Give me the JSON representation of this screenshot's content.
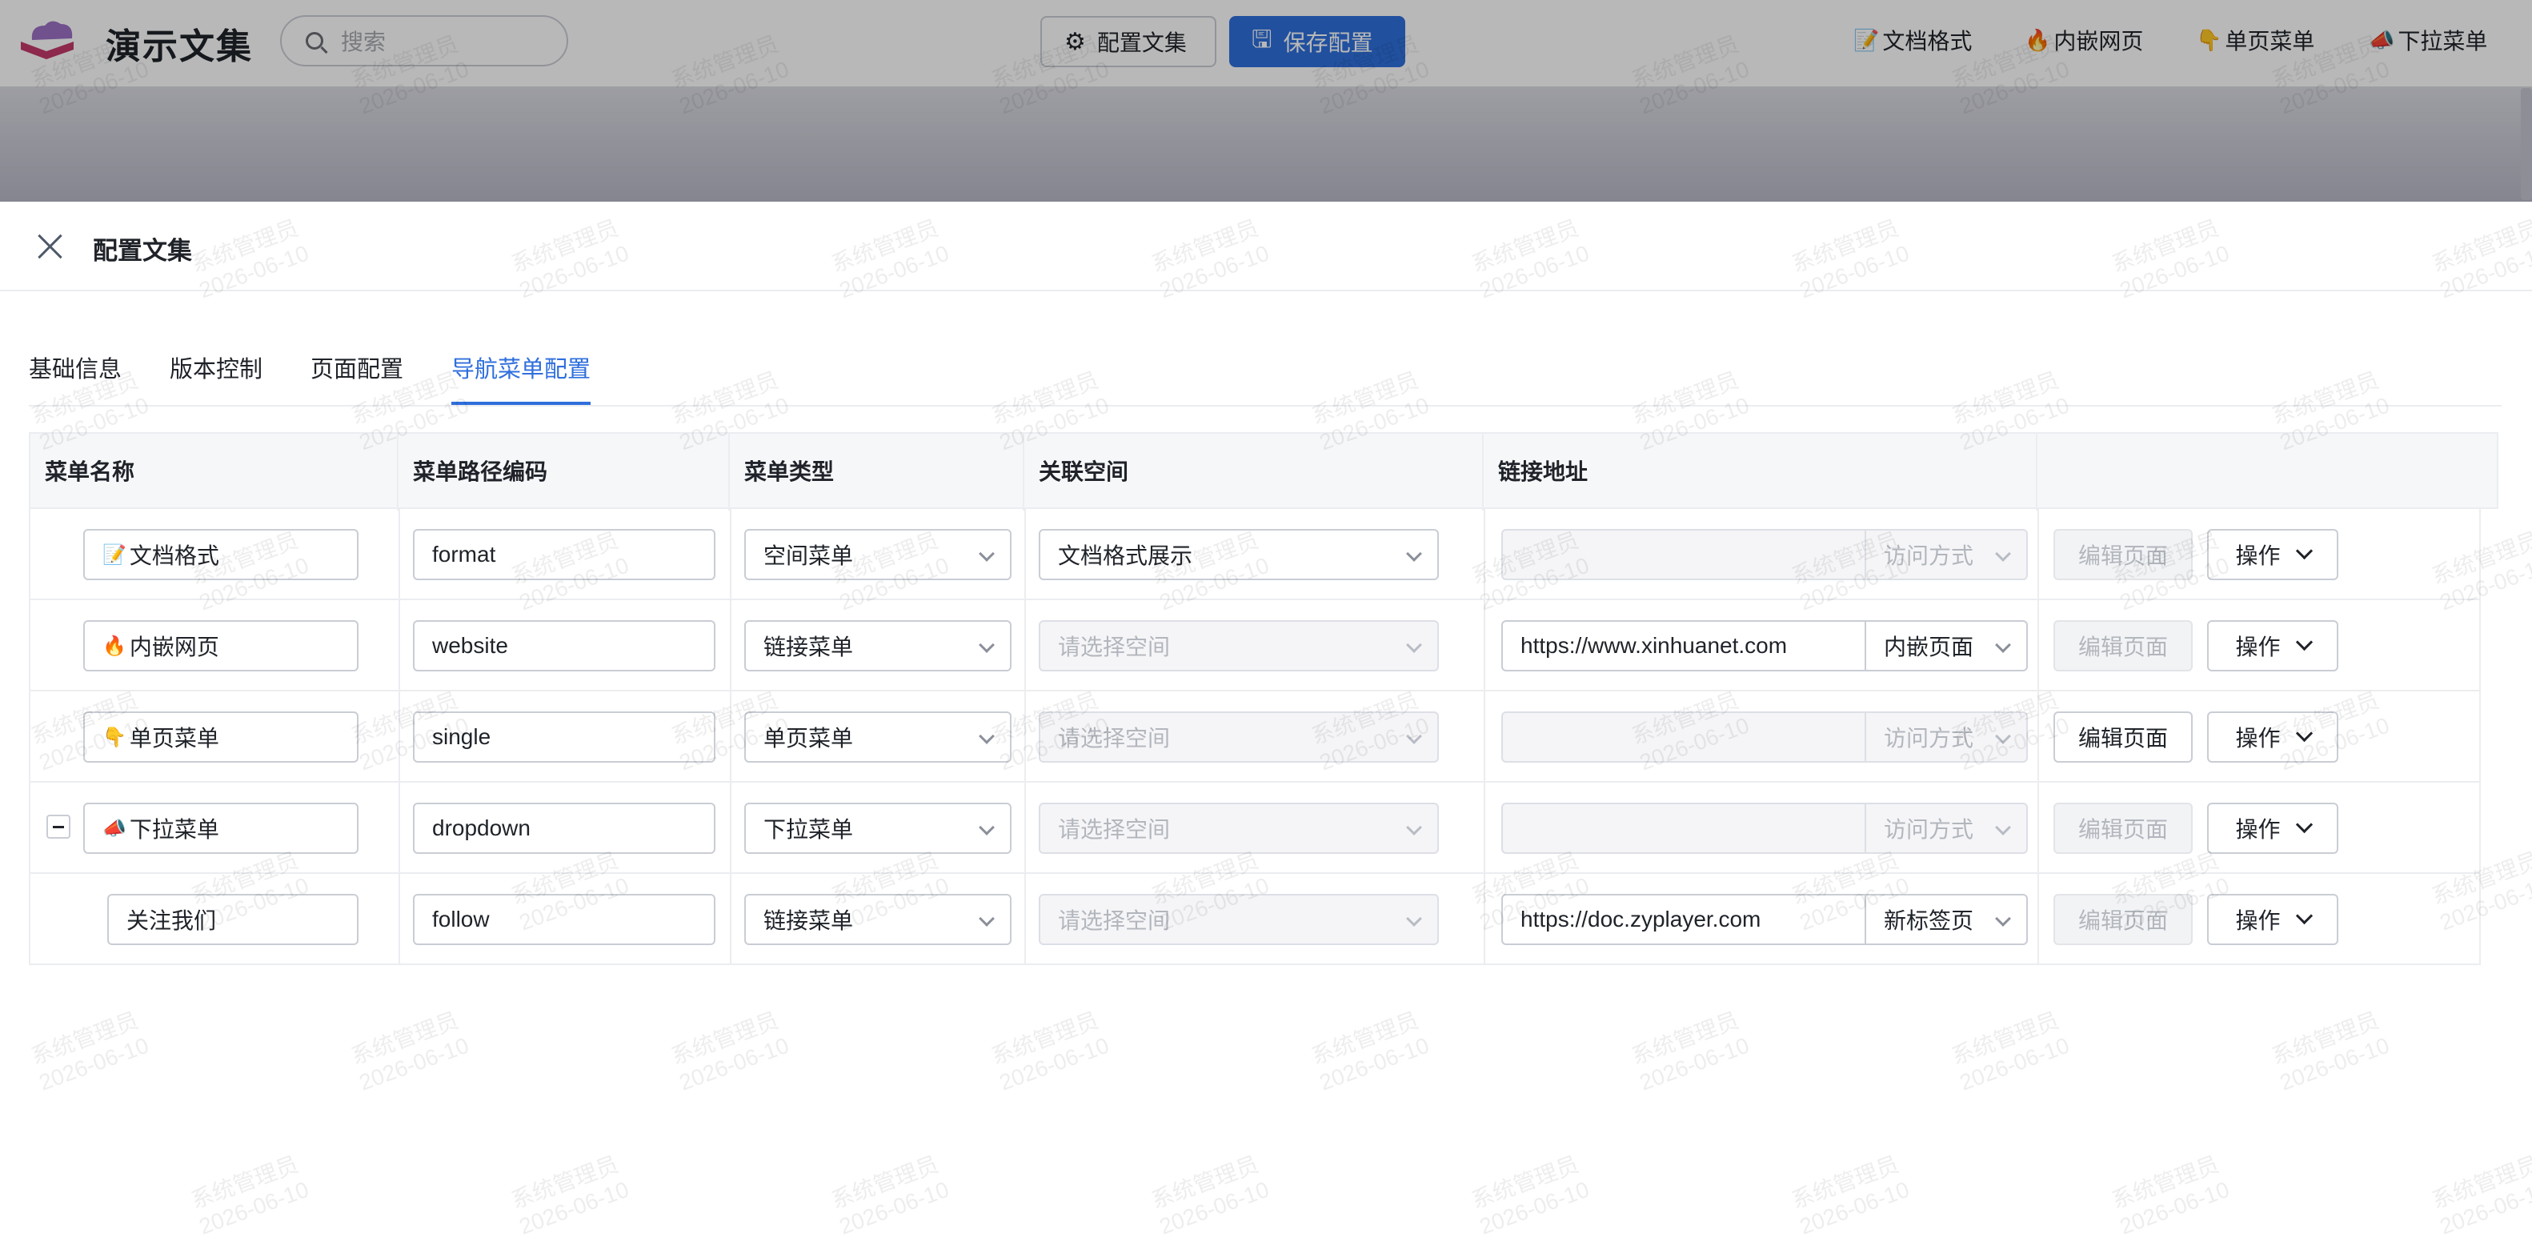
{
  "header": {
    "app_title": "演示文集",
    "search_placeholder": "搜索",
    "config_button": "配置文集",
    "save_button": "保存配置",
    "nav": [
      {
        "icon": "📝",
        "label": "文档格式"
      },
      {
        "icon": "🔥",
        "label": "内嵌网页"
      },
      {
        "icon": "👇",
        "label": "单页菜单"
      },
      {
        "icon": "📣",
        "label": "下拉菜单"
      }
    ]
  },
  "drawer": {
    "title": "配置文集",
    "tabs": [
      "基础信息",
      "版本控制",
      "页面配置",
      "导航菜单配置"
    ],
    "active_tab": "导航菜单配置"
  },
  "table": {
    "columns": [
      "菜单名称",
      "菜单路径编码",
      "菜单类型",
      "关联空间",
      "链接地址",
      ""
    ],
    "rows": [
      {
        "icon": "📝",
        "name": "文档格式",
        "code": "format",
        "type": "空间菜单",
        "space": "文档格式展示",
        "space_disabled": false,
        "url": "",
        "url_placeholder": "",
        "url_disabled": true,
        "access": "访问方式",
        "access_disabled": true,
        "edit": "编辑页面",
        "edit_disabled": true,
        "action": "操作"
      },
      {
        "icon": "🔥",
        "name": "内嵌网页",
        "code": "website",
        "type": "链接菜单",
        "space": "请选择空间",
        "space_disabled": true,
        "url": "https://www.xinhuanet.com",
        "url_disabled": false,
        "access": "内嵌页面",
        "access_disabled": false,
        "edit": "编辑页面",
        "edit_disabled": true,
        "action": "操作"
      },
      {
        "icon": "👇",
        "name": "单页菜单",
        "code": "single",
        "type": "单页菜单",
        "space": "请选择空间",
        "space_disabled": true,
        "url": "",
        "url_disabled": true,
        "access": "访问方式",
        "access_disabled": true,
        "edit": "编辑页面",
        "edit_disabled": false,
        "action": "操作"
      },
      {
        "icon": "📣",
        "name": "下拉菜单",
        "code": "dropdown",
        "type": "下拉菜单",
        "space": "请选择空间",
        "space_disabled": true,
        "url": "",
        "url_disabled": true,
        "access": "访问方式",
        "access_disabled": true,
        "edit": "编辑页面",
        "edit_disabled": true,
        "action": "操作",
        "expanded": true
      },
      {
        "icon": "",
        "name": "关注我们",
        "code": "follow",
        "type": "链接菜单",
        "space": "请选择空间",
        "space_disabled": true,
        "url": "https://doc.zyplayer.com",
        "url_disabled": false,
        "access": "新标签页",
        "access_disabled": false,
        "edit": "编辑页面",
        "edit_disabled": true,
        "action": "操作",
        "child": true
      }
    ]
  },
  "watermark": {
    "line1": "系统管理员",
    "line2": "2026-06-10"
  },
  "colors": {
    "primary": "#2f6fdc",
    "border": "#c9cdd4",
    "disabled_bg": "#f5f5f7"
  }
}
